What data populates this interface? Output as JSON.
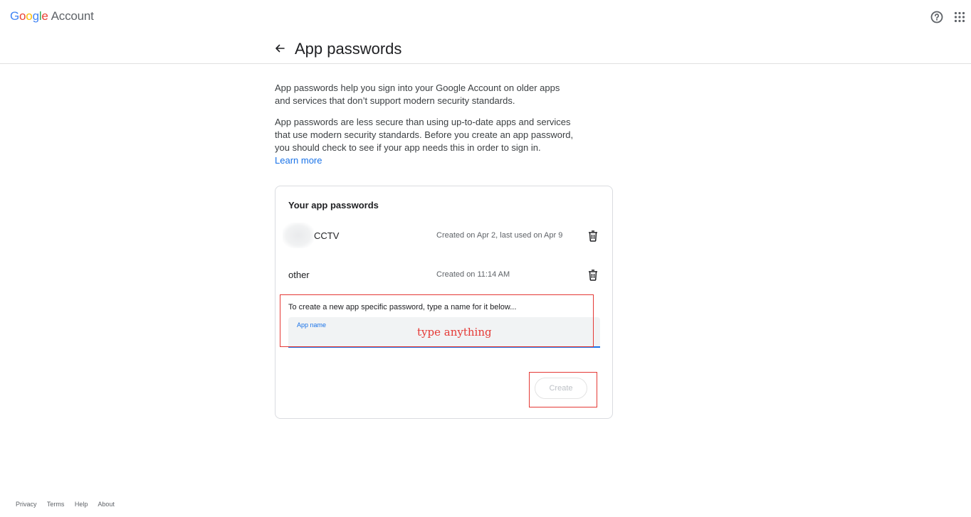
{
  "topbar": {
    "logo_letters": [
      "G",
      "o",
      "o",
      "g",
      "l",
      "e"
    ],
    "account_label": "Account",
    "help_icon": "help-circle-icon",
    "apps_icon": "apps-grid-icon"
  },
  "header": {
    "back_icon": "arrow-back-icon",
    "title": "App passwords"
  },
  "intro": {
    "paragraph1": "App passwords help you sign into your Google Account on older apps and services that don’t support modern security standards.",
    "paragraph2": "App passwords are less secure than using up-to-date apps and services that use modern security standards. Before you create an app password, you should check to see if your app needs this in order to sign in.",
    "learn_more": "Learn more"
  },
  "card": {
    "title": "Your app passwords",
    "passwords": [
      {
        "name": "CCTV",
        "meta": "Created on Apr 2, last used on Apr 9"
      },
      {
        "name": "other",
        "meta": "Created on 11:14 AM"
      }
    ],
    "delete_icon": "trash-icon",
    "create_hint": "To create a new app specific password, type a name for it below...",
    "field_label": "App name",
    "field_value": "",
    "create_label": "Create"
  },
  "annotation": {
    "text": "type anything",
    "color": "#e53935"
  },
  "footer": {
    "links": [
      "Privacy",
      "Terms",
      "Help",
      "About"
    ]
  },
  "colors": {
    "accent": "#1a73e8",
    "annotation_red": "#e53935",
    "text_primary": "#202124",
    "text_secondary": "#5f6368"
  }
}
